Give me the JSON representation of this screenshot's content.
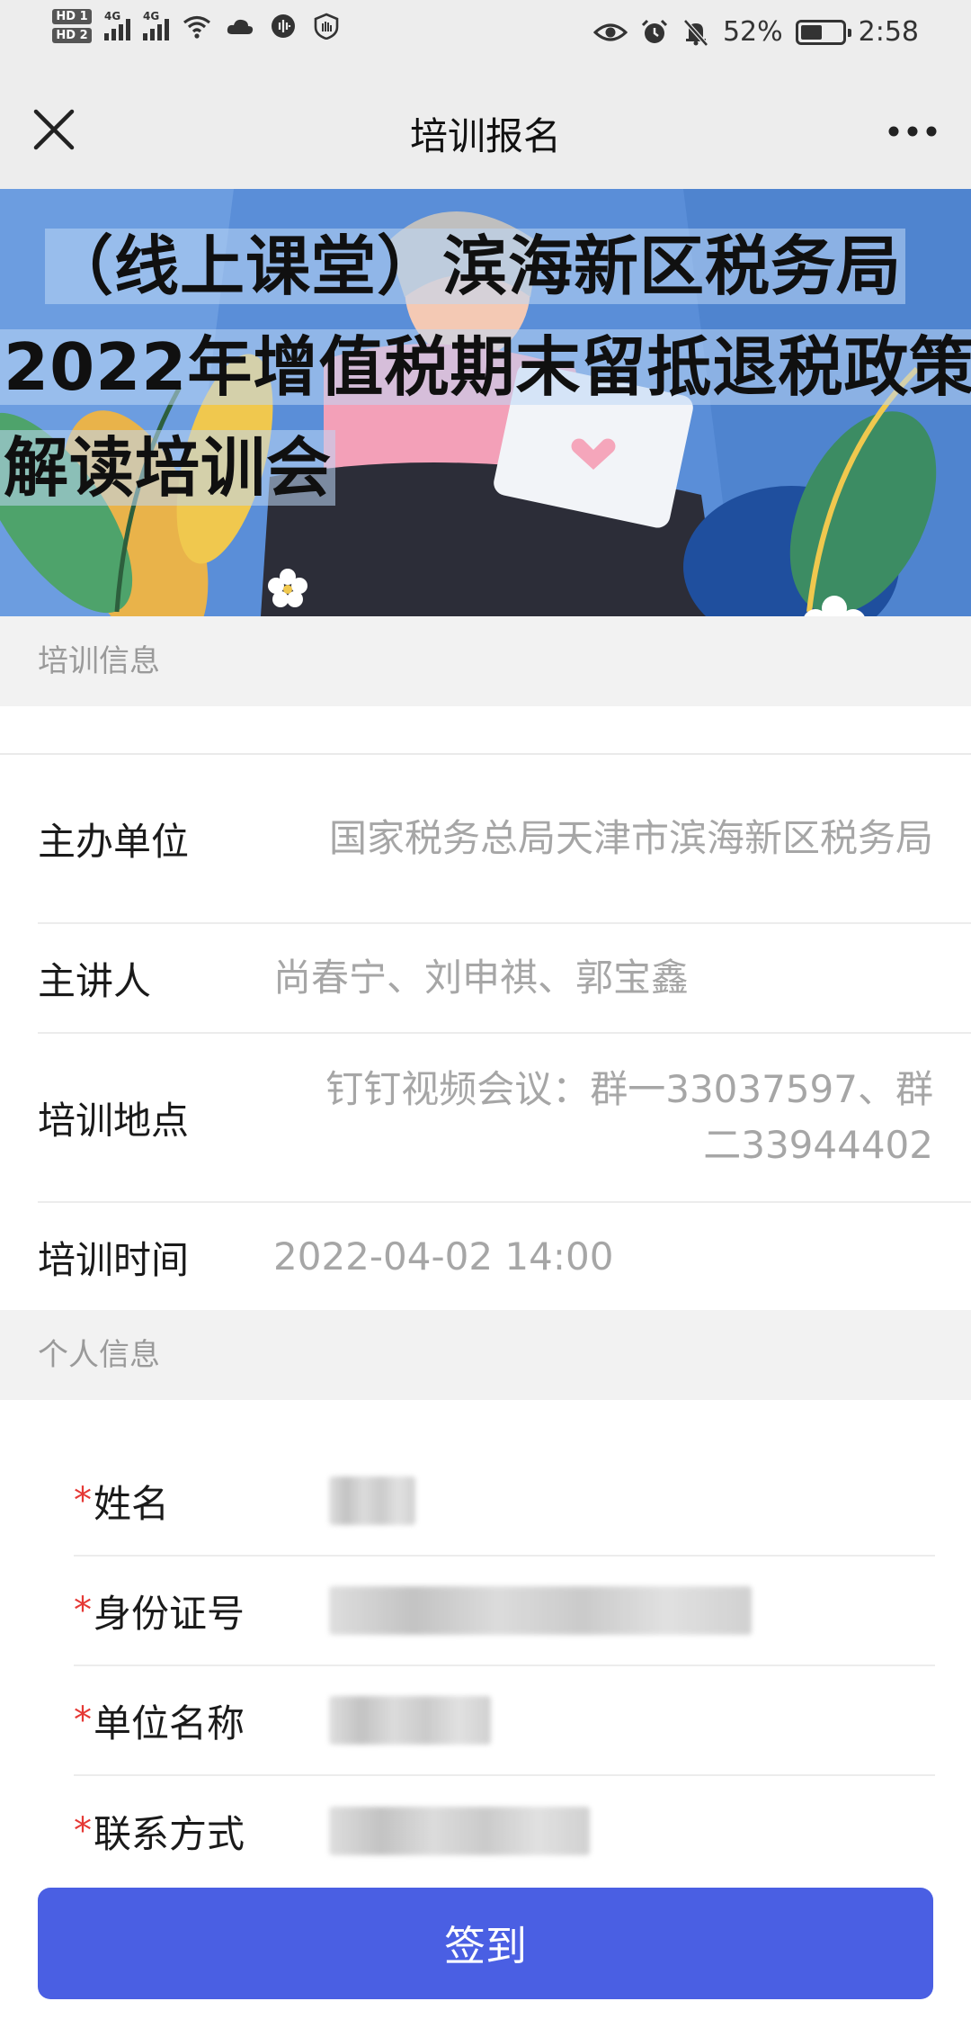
{
  "status_bar": {
    "hd1": "HD 1",
    "hd2": "HD 2",
    "net1": "4G",
    "net2": "4G",
    "battery_pct_text": "52%",
    "battery_level": 0.52,
    "time": "2:58"
  },
  "nav": {
    "title": "培训报名"
  },
  "banner": {
    "line1": "（线上课堂）滨海新区税务局",
    "line2": "2022年增值税期末留抵退税政策",
    "line3": "解读培训会"
  },
  "training_section": {
    "header": "培训信息",
    "rows": [
      {
        "label": "主办单位",
        "value": "国家税务总局天津市滨海新区税务局"
      },
      {
        "label": "主讲人",
        "value": "尚春宁、刘申祺、郭宝鑫"
      },
      {
        "label": "培训地点",
        "value": "钉钉视频会议：群一33037597、群二33944402"
      },
      {
        "label": "培训时间",
        "value": "2022-04-02 14:00"
      }
    ]
  },
  "personal_section": {
    "header": "个人信息",
    "required_mark": "*",
    "fields": [
      {
        "label": "姓名"
      },
      {
        "label": "身份证号"
      },
      {
        "label": "单位名称"
      },
      {
        "label": "联系方式"
      }
    ]
  },
  "submit_label": "签到",
  "colors": {
    "accent": "#4a5fe3",
    "required": "#e53935",
    "section_bg": "#f2f2f2",
    "value_text": "#a6a6a6"
  }
}
